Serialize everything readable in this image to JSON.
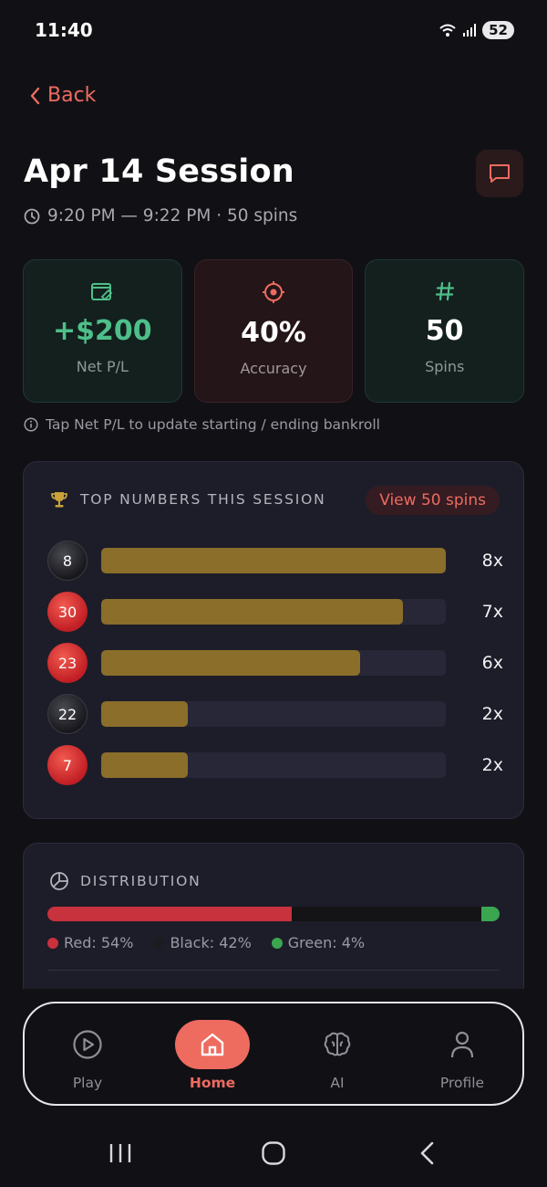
{
  "status": {
    "time": "11:40",
    "battery": "52"
  },
  "header": {
    "back_label": "Back",
    "title": "Apr 14 Session",
    "time_range": "9:20 PM — 9:22 PM · 50 spins"
  },
  "stats": [
    {
      "value": "+$200",
      "label": "Net P/L",
      "icon": "wallet-icon",
      "color": "#4fbf8a"
    },
    {
      "value": "40%",
      "label": "Accuracy",
      "icon": "target-icon",
      "color": "#ee6b60"
    },
    {
      "value": "50",
      "label": "Spins",
      "icon": "hash-icon",
      "color": "#4fbf8a"
    }
  ],
  "hint": "Tap Net P/L to update starting / ending bankroll",
  "top_numbers": {
    "heading": "TOP NUMBERS THIS SESSION",
    "view_label": "View 50 spins",
    "rows": [
      {
        "number": "8",
        "color": "black",
        "count": "8x",
        "fraction": 1.0
      },
      {
        "number": "30",
        "color": "red",
        "count": "7x",
        "fraction": 0.875
      },
      {
        "number": "23",
        "color": "red",
        "count": "6x",
        "fraction": 0.75
      },
      {
        "number": "22",
        "color": "black",
        "count": "2x",
        "fraction": 0.25
      },
      {
        "number": "7",
        "color": "red",
        "count": "2x",
        "fraction": 0.25
      }
    ]
  },
  "distribution": {
    "heading": "DISTRIBUTION",
    "segments": [
      {
        "label": "Red: 54%",
        "percent": 54,
        "color": "#c8323c"
      },
      {
        "label": "Black: 42%",
        "percent": 42,
        "color": "#141417"
      },
      {
        "label": "Green: 4%",
        "percent": 4,
        "color": "#3aa650"
      }
    ]
  },
  "nav": {
    "items": [
      {
        "label": "Play",
        "icon": "play-icon"
      },
      {
        "label": "Home",
        "icon": "home-icon",
        "active": true
      },
      {
        "label": "AI",
        "icon": "brain-icon"
      },
      {
        "label": "Profile",
        "icon": "profile-icon"
      }
    ]
  }
}
